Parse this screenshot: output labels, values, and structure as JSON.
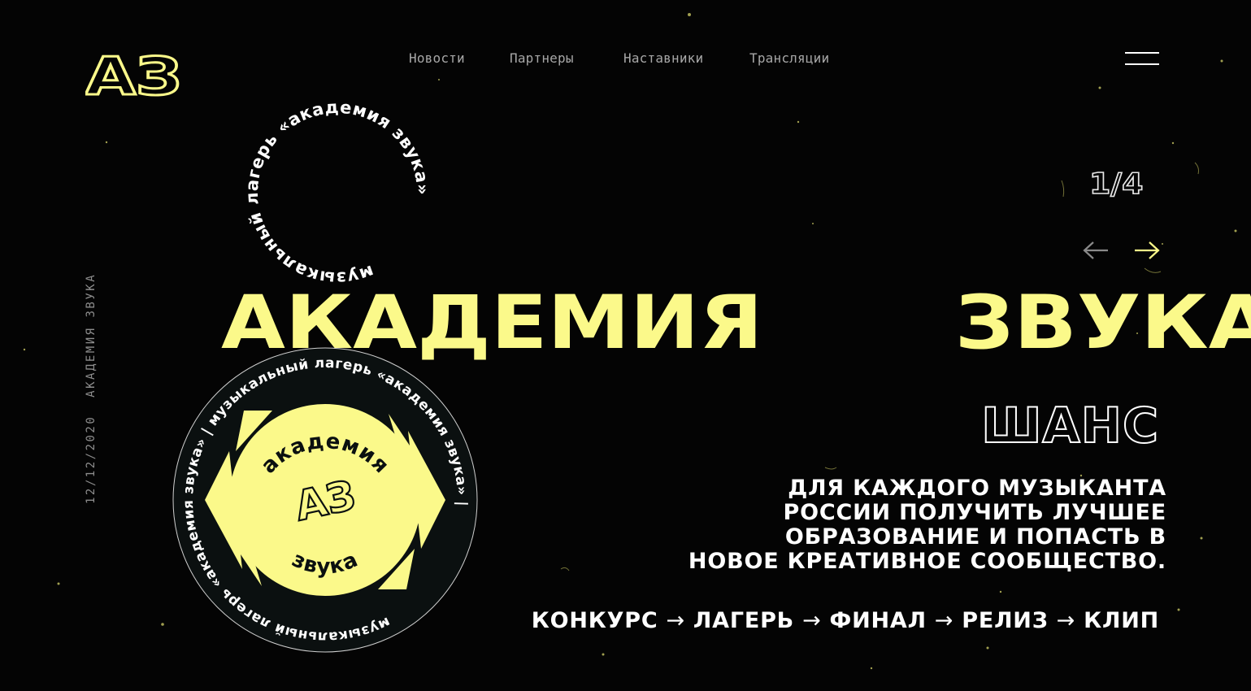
{
  "logo": {
    "text": "АЗ",
    "color": "#fbf98a"
  },
  "nav": {
    "items": [
      {
        "label": "Новости"
      },
      {
        "label": "Партнеры"
      },
      {
        "label": "Наставники"
      },
      {
        "label": "Трансляции"
      }
    ],
    "menu_icon": "hamburger-menu-icon"
  },
  "sidebar": {
    "vertical_text": "12/12/2020  АКАДЕМИЯ ЗВУКА"
  },
  "slider": {
    "counter": "1/4",
    "prev_icon": "arrow-left-icon",
    "next_icon": "arrow-right-icon"
  },
  "stamps": {
    "ring_text": "музыкальный лагерь «академия звука» ",
    "badge_ring_text": "музыкальный лагерь «академия звука» | музыкальный лагерь «академия звука» | ",
    "badge_top": "академия",
    "badge_logo": "АЗ",
    "badge_bottom": "звука"
  },
  "hero": {
    "title_word1": "АКАДЕМИЯ",
    "title_word2": "ЗВУКА",
    "chance": "ШАНС",
    "description_lines": [
      "ДЛЯ КАЖДОГО МУЗЫКАНТА",
      "РОССИИ ПОЛУЧИТЬ ЛУЧШЕЕ",
      "ОБРАЗОВАНИЕ И ПОПАСТЬ В",
      "НОВОЕ КРЕАТИВНОЕ СООБЩЕСТВО."
    ],
    "steps": [
      "КОНКУРС",
      "ЛАГЕРЬ",
      "ФИНАЛ",
      "РЕЛИЗ",
      "КЛИП"
    ],
    "step_separator": "→"
  },
  "colors": {
    "accent": "#fbf98a",
    "background": "#040404",
    "nav_text": "#a7a7a7",
    "badge_bg": "#0b1010"
  }
}
